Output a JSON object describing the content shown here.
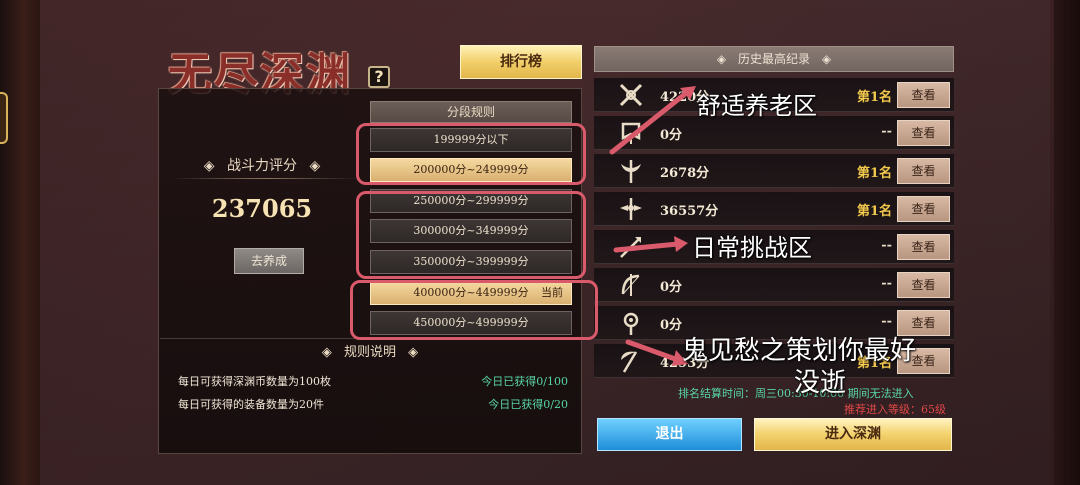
{
  "title": "无尽深渊",
  "help_icon": "?",
  "rank_button": "排行榜",
  "power": {
    "label": "战斗力评分",
    "value": "237065",
    "cultivate_button": "去养成"
  },
  "segments": {
    "header": "分段规则",
    "current_label": "当前",
    "items": [
      "199999分以下",
      "200000分~249999分",
      "250000分~299999分",
      "300000分~349999分",
      "350000分~399999分",
      "400000分~449999分",
      "450000分~499999分"
    ]
  },
  "rules": {
    "header": "规则说明",
    "lines": [
      {
        "text": "每日可获得深渊币数量为100枚",
        "status": "今日已获得0/100"
      },
      {
        "text": "每日可获得的装备数量为20件",
        "status": "今日已获得0/20"
      }
    ]
  },
  "records": {
    "header": "历史最高纪录",
    "view_label": "查看",
    "rows": [
      {
        "icon": "crossed-swords-icon",
        "score": "4220分",
        "rank": "第1名"
      },
      {
        "icon": "banner-icon",
        "score": "0分",
        "rank": "--"
      },
      {
        "icon": "axe-icon",
        "score": "2678分",
        "rank": "第1名"
      },
      {
        "icon": "winged-sword-icon",
        "score": "36557分",
        "rank": "第1名"
      },
      {
        "icon": "spear-icon",
        "score": "",
        "rank": "--"
      },
      {
        "icon": "bow-icon",
        "score": "0分",
        "rank": "--"
      },
      {
        "icon": "orb-staff-icon",
        "score": "0分",
        "rank": "--"
      },
      {
        "icon": "scythe-icon",
        "score": "4293分",
        "rank": "第1名"
      }
    ]
  },
  "settlement": {
    "time_text": "排名结算时间：周三00:30-10:00 期间无法进入",
    "recommend_text": "推荐进入等级：65级"
  },
  "buttons": {
    "exit": "退出",
    "enter": "进入深渊"
  },
  "annotations": {
    "comfort_zone": "舒适养老区",
    "daily_challenge": "日常挑战区",
    "note_line1": "鬼见愁之策划你最好",
    "note_line2": "没逝"
  },
  "colors": {
    "annotation_red": "#d95a6a",
    "gold_accent": "#f2c94c",
    "status_green": "#58d6a6",
    "warning_red": "#e04848"
  }
}
